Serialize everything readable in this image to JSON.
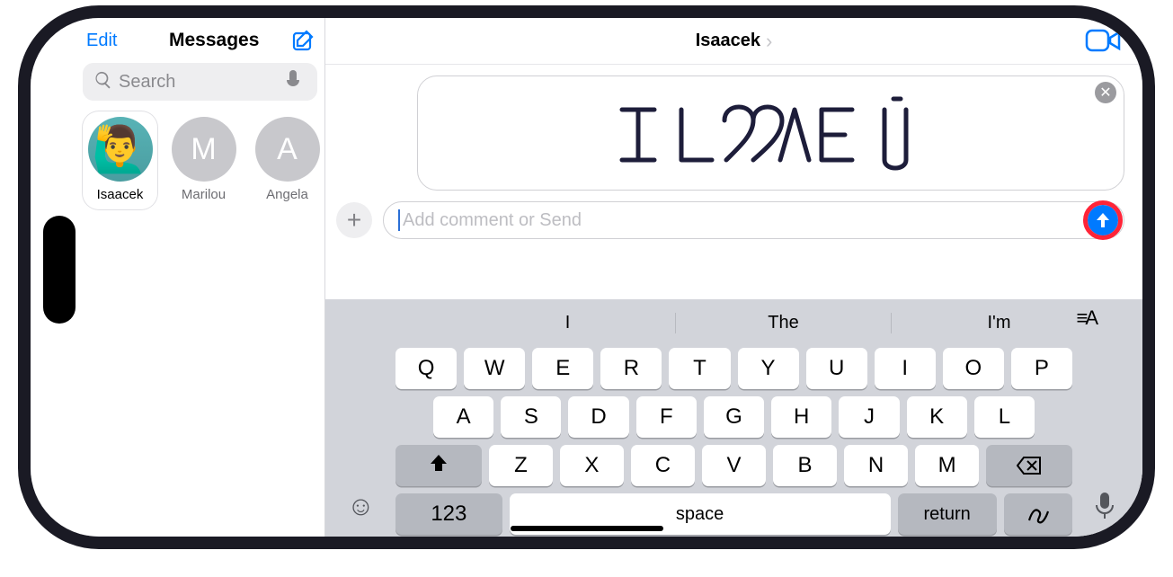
{
  "sidebar": {
    "edit_label": "Edit",
    "title": "Messages",
    "search_placeholder": "Search",
    "pins": [
      {
        "name": "Isaacek",
        "initial": "",
        "selected": true
      },
      {
        "name": "Marilou",
        "initial": "M",
        "selected": false
      },
      {
        "name": "Angela",
        "initial": "A",
        "selected": false
      }
    ]
  },
  "conversation": {
    "contact_name": "Isaacek",
    "handwriting_text": "I L♡VE U",
    "input_placeholder": "Add comment or Send",
    "input_value": ""
  },
  "keyboard": {
    "suggestions": [
      "I",
      "The",
      "I'm"
    ],
    "rows": {
      "r1": [
        "Q",
        "W",
        "E",
        "R",
        "T",
        "Y",
        "U",
        "I",
        "O",
        "P"
      ],
      "r2": [
        "A",
        "S",
        "D",
        "F",
        "G",
        "H",
        "J",
        "K",
        "L"
      ],
      "r3_letters": [
        "Z",
        "X",
        "C",
        "V",
        "B",
        "N",
        "M"
      ]
    },
    "num_label": "123",
    "space_label": "space",
    "return_label": "return"
  },
  "colors": {
    "accent": "#007aff",
    "highlight": "#ff2438"
  }
}
